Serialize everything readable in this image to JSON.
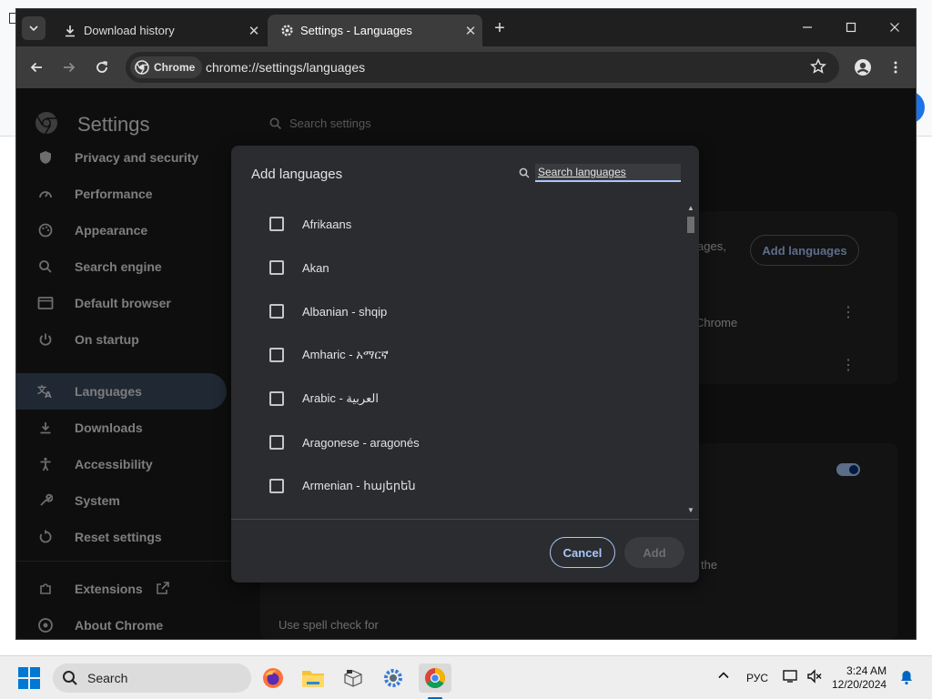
{
  "browser": {
    "tabs": [
      {
        "label": "Download history",
        "icon": "download-icon",
        "active": false
      },
      {
        "label": "Settings - Languages",
        "icon": "gear-icon",
        "active": true
      }
    ],
    "omnibox": {
      "chip_label": "Chrome",
      "url": "chrome://settings/languages"
    }
  },
  "settings": {
    "title": "Settings",
    "search_placeholder": "Search settings",
    "sidebar": {
      "items": [
        {
          "label": "Privacy and security",
          "icon": "shield-icon"
        },
        {
          "label": "Performance",
          "icon": "gauge-icon"
        },
        {
          "label": "Appearance",
          "icon": "palette-icon"
        },
        {
          "label": "Search engine",
          "icon": "search-icon"
        },
        {
          "label": "Default browser",
          "icon": "browser-window-icon"
        },
        {
          "label": "On startup",
          "icon": "power-icon"
        },
        {
          "label": "Languages",
          "icon": "translate-icon",
          "selected": true
        },
        {
          "label": "Downloads",
          "icon": "download-icon"
        },
        {
          "label": "Accessibility",
          "icon": "accessibility-icon"
        },
        {
          "label": "System",
          "icon": "wrench-icon"
        },
        {
          "label": "Reset settings",
          "icon": "reset-icon"
        },
        {
          "label": "Extensions",
          "icon": "puzzle-icon"
        },
        {
          "label": "About Chrome",
          "icon": "chrome-icon"
        }
      ]
    },
    "background": {
      "add_languages_label": "Add languages",
      "partial_text_1": "ages,",
      "partial_text_2": "Chrome",
      "partial_text_3": "the",
      "spell_check_label": "Use spell check for"
    }
  },
  "dialog": {
    "title": "Add languages",
    "search_placeholder": "Search languages",
    "languages": [
      "Afrikaans",
      "Akan",
      "Albanian - shqip",
      "Amharic - አማርኛ",
      "Arabic - العربية",
      "Aragonese - aragonés",
      "Armenian - հայերեն"
    ],
    "cancel_label": "Cancel",
    "add_label": "Add"
  },
  "taskbar": {
    "search_label": "Search",
    "language_indicator": "РУС",
    "time": "3:24 AM",
    "date": "12/20/2024"
  },
  "colors": {
    "accent": "#a8c7fa",
    "selected_nav": "#3b4a5e",
    "dialog_bg": "#2b2c2f",
    "page_bg": "#1b1b1b",
    "taskbar_active": "#0067c0"
  }
}
